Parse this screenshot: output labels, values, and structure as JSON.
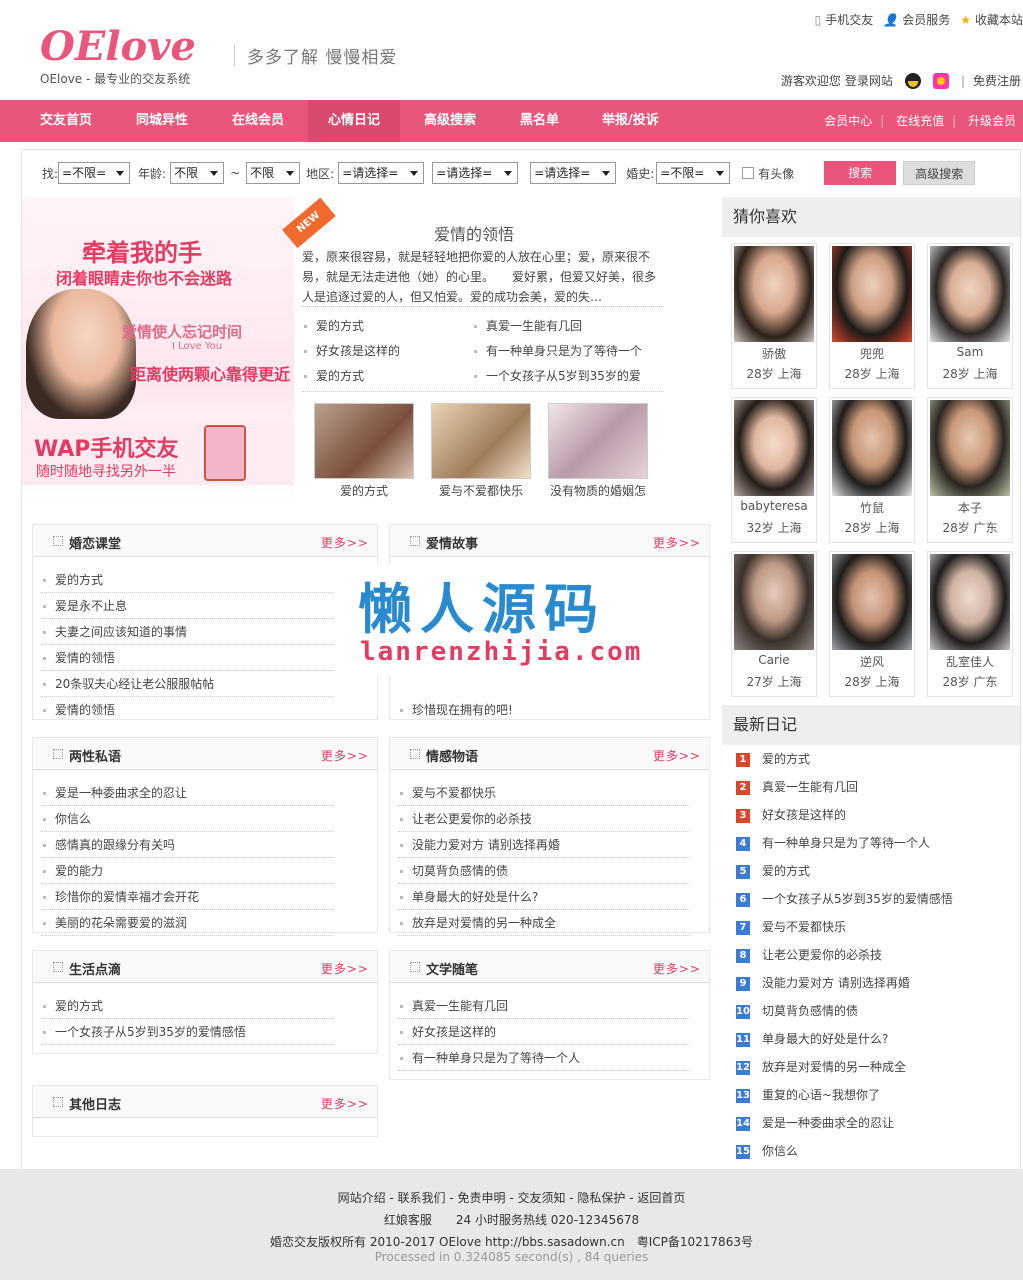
{
  "header": {
    "logo": "OElove",
    "logo_sub": "OElove - 最专业的交友系统",
    "slogan": "多多了解  慢慢相爱",
    "top_links": [
      "手机交友",
      "会员服务",
      "收藏本站"
    ],
    "welcome": "游客欢迎您",
    "login": "登录网站",
    "register": "免费注册"
  },
  "nav": {
    "items": [
      "交友首页",
      "同城异性",
      "在线会员",
      "心情日记",
      "高级搜索",
      "黑名单",
      "举报/投诉"
    ],
    "active_index": 3,
    "right": [
      "会员中心",
      "在线充值",
      "升级会员"
    ]
  },
  "search": {
    "label_find": "找:",
    "find_value": "=不限=",
    "label_age": "年龄:",
    "age_from": "不限",
    "tilde": "~",
    "age_to": "不限",
    "label_area": "地区:",
    "area1": "=请选择=",
    "area2": "=请选择=",
    "area3": "=请选择=",
    "label_marriage": "婚史:",
    "marriage": "=不限=",
    "has_photo": "有头像",
    "search_button": "搜索",
    "advanced_button": "高级搜索"
  },
  "banner": {
    "line1": "牵着我的手",
    "line2": "闭着眼睛走你也不会迷路",
    "line3": "爱情使人忘记时间",
    "line3_en": "I Love You",
    "line4": "距离使两颗心靠得更近",
    "wap_title": "WAP手机交友",
    "wap_sub": "随时随地寻找另外一半"
  },
  "featured": {
    "badge": "NEW",
    "title": "爱情的领悟",
    "body": "爱，原来很容易，就是轻轻地把你爱的人放在心里；爱，原来很不易，就是无法走进他（她）的心里。　　爱好累，但爱又好美，很多人是追逐过爱的人，但又怕爱。爱的成功会美，爱的失…",
    "links_left": [
      "爱的方式",
      "好女孩是这样的",
      "爱的方式"
    ],
    "links_right": [
      "真爱一生能有几回",
      "有一种单身只是为了等待一个",
      "一个女孩子从5岁到35岁的爱"
    ],
    "thumbs": [
      "爱的方式",
      "爱与不爱都快乐",
      "没有物质的婚姻怎"
    ]
  },
  "boxes": {
    "more": "更多>>",
    "hunlian": {
      "title": "婚恋课堂",
      "items": [
        "爱的方式",
        "爱是永不止息",
        "夫妻之间应该知道的事情",
        "爱情的领悟",
        "20条驭夫心经让老公服服帖帖",
        "爱情的领悟"
      ]
    },
    "aiqing": {
      "title": "爱情故事",
      "items": [
        "珍惜现在拥有的吧!"
      ]
    },
    "liangxing": {
      "title": "两性私语",
      "items": [
        "爱是一种委曲求全的忍让",
        "你信么",
        "感情真的跟缘分有关吗",
        "爱的能力",
        "珍惜你的爱情幸福才会开花",
        "美丽的花朵需要爱的滋润"
      ]
    },
    "qinggan": {
      "title": "情感物语",
      "items": [
        "爱与不爱都快乐",
        "让老公更爱你的必杀技",
        "没能力爱对方 请别选择再婚",
        "切莫背负感情的债",
        "单身最大的好处是什么?",
        "放弃是对爱情的另一种成全"
      ]
    },
    "shenghuo": {
      "title": "生活点滴",
      "items": [
        "爱的方式",
        "一个女孩子从5岁到35岁的爱情感悟"
      ]
    },
    "wenxue": {
      "title": "文学随笔",
      "items": [
        "真爱一生能有几回",
        "好女孩是这样的",
        "有一种单身只是为了等待一个人"
      ]
    },
    "qita": {
      "title": "其他日志",
      "items": []
    }
  },
  "watermark": {
    "cn": "懒人源码",
    "en": "lanrenzhijia.com"
  },
  "sidebar": {
    "guess_title": "猜你喜欢",
    "members": [
      {
        "name": "骄傲",
        "info": "28岁 上海"
      },
      {
        "name": "兜兜",
        "info": "28岁 上海"
      },
      {
        "name": "Sam",
        "info": "28岁 上海"
      },
      {
        "name": "babyteresa",
        "info": "32岁 上海"
      },
      {
        "name": "竹鼠",
        "info": "28岁 上海"
      },
      {
        "name": "本子",
        "info": "28岁 广东"
      },
      {
        "name": "Carie",
        "info": "27岁 上海"
      },
      {
        "name": "逆风",
        "info": "28岁 上海"
      },
      {
        "name": "乱室佳人",
        "info": "28岁 广东"
      }
    ],
    "latest_title": "最新日记",
    "latest": [
      "爱的方式",
      "真爱一生能有几回",
      "好女孩是这样的",
      "有一种单身只是为了等待一个人",
      "爱的方式",
      "一个女孩子从5岁到35岁的爱情感悟",
      "爱与不爱都快乐",
      "让老公更爱你的必杀技",
      "没能力爱对方 请别选择再婚",
      "切莫背负感情的债",
      "单身最大的好处是什么?",
      "放弃是对爱情的另一种成全",
      "重复的心语~我想你了",
      "爱是一种委曲求全的忍让",
      "你信么"
    ],
    "latest_nums": [
      "1",
      "2",
      "3",
      "4",
      "5",
      "6",
      "7",
      "8",
      "9",
      "10",
      "11",
      "12",
      "13",
      "14",
      "15"
    ]
  },
  "footer": {
    "links": "网站介绍 - 联系我们 - 免责申明 - 交友须知 - 隐私保护 - 返回首页",
    "service": "红娘客服　　24 小时服务热线 020-12345678",
    "copyright": "婚恋交友版权所有 2010-2017 OElove http://bbs.sasadown.cn　粤ICP备10217863号",
    "processed": "Processed in 0.324085 second(s) , 84 queries"
  },
  "colors": {
    "accent": "#e9557b",
    "rank_top": "#d9472b",
    "rank_rest": "#3a7bd5"
  }
}
